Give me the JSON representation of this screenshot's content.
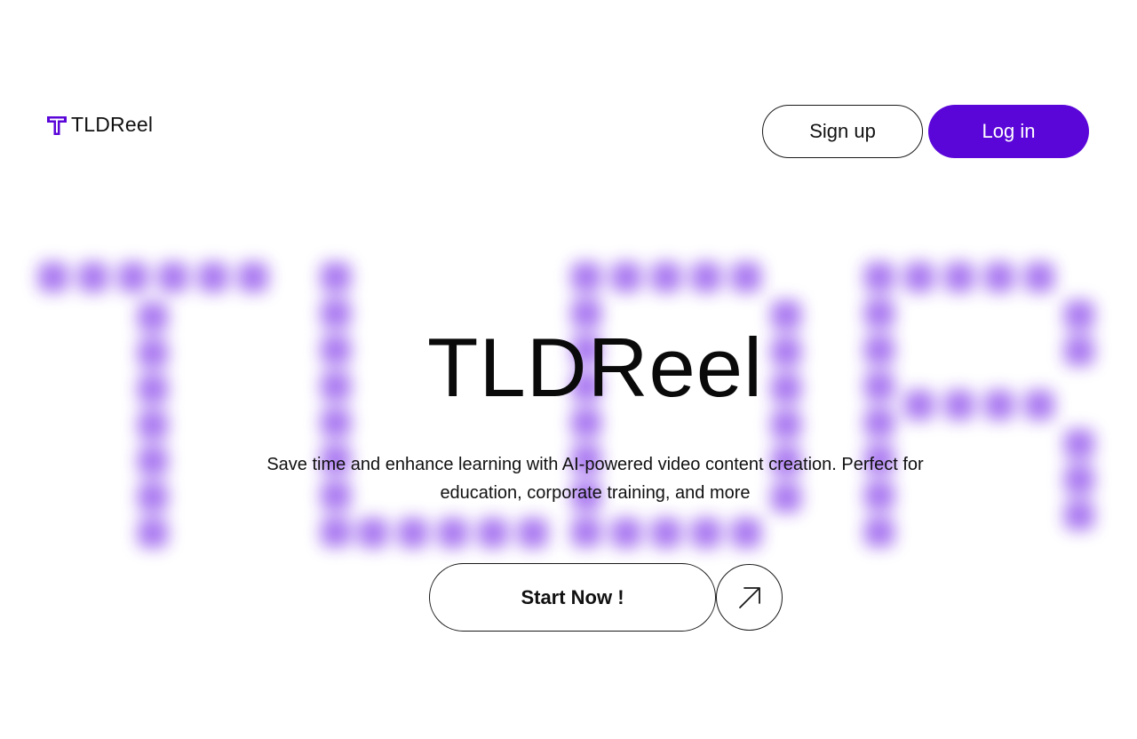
{
  "brand": {
    "name": "TLDReel",
    "icon": "tldreel-logo-icon",
    "color": "#5b06d9"
  },
  "header": {
    "signup_label": "Sign up",
    "login_label": "Log in"
  },
  "hero": {
    "background_word": "TLDR",
    "background_color": "#a673f0",
    "title": "TLDReel",
    "subtitle_line1": "Save time and enhance learning with AI-powered video content creation. Perfect for",
    "subtitle_line2": "education, corporate training, and more",
    "cta_label": "Start Now !",
    "cta_icon": "arrow-up-right-icon"
  },
  "colors": {
    "accent": "#5b06d9",
    "background": "#ffffff",
    "text": "#000000"
  }
}
